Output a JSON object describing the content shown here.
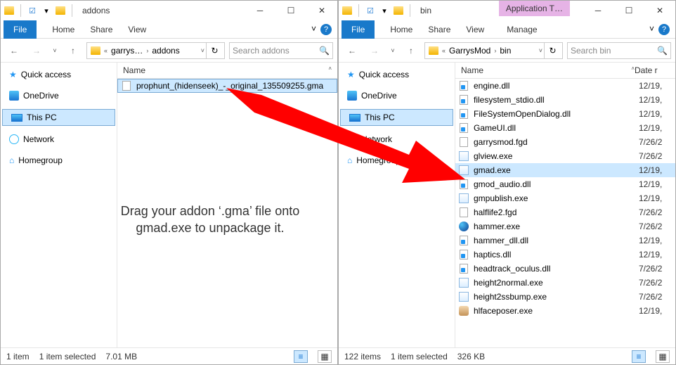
{
  "left": {
    "title": "addons",
    "ribbon": {
      "file": "File",
      "home": "Home",
      "share": "Share",
      "view": "View"
    },
    "breadcrumbs": [
      "garrys…",
      "addons"
    ],
    "search_placeholder": "Search addons",
    "nav": {
      "quick": "Quick access",
      "onedrive": "OneDrive",
      "thispc": "This PC",
      "network": "Network",
      "homegroup": "Homegroup"
    },
    "columns": {
      "name": "Name"
    },
    "files": [
      {
        "name": "prophunt_(hidenseek)_-_original_135509255.gma"
      }
    ],
    "status": {
      "count": "1 item",
      "sel": "1 item selected",
      "size": "7.01 MB"
    }
  },
  "right": {
    "title": "bin",
    "context_tab": "Application T…",
    "ribbon": {
      "file": "File",
      "home": "Home",
      "share": "Share",
      "view": "View",
      "manage": "Manage"
    },
    "breadcrumbs": [
      "GarrysMod",
      "bin"
    ],
    "search_placeholder": "Search bin",
    "nav": {
      "quick": "Quick access",
      "onedrive": "OneDrive",
      "thispc": "This PC",
      "network": "Network",
      "homegroup": "Homegroup"
    },
    "columns": {
      "name": "Name",
      "date": "Date r"
    },
    "files": [
      {
        "name": "engine.dll",
        "date": "12/19,",
        "type": "dll"
      },
      {
        "name": "filesystem_stdio.dll",
        "date": "12/19,",
        "type": "dll"
      },
      {
        "name": "FileSystemOpenDialog.dll",
        "date": "12/19,",
        "type": "dll"
      },
      {
        "name": "GameUI.dll",
        "date": "12/19,",
        "type": "dll"
      },
      {
        "name": "garrysmod.fgd",
        "date": "7/26/2",
        "type": "file"
      },
      {
        "name": "glview.exe",
        "date": "7/26/2",
        "type": "exe"
      },
      {
        "name": "gmad.exe",
        "date": "12/19,",
        "type": "exe",
        "sel": true
      },
      {
        "name": "gmod_audio.dll",
        "date": "12/19,",
        "type": "dll"
      },
      {
        "name": "gmpublish.exe",
        "date": "12/19,",
        "type": "exe"
      },
      {
        "name": "halflife2.fgd",
        "date": "7/26/2",
        "type": "file"
      },
      {
        "name": "hammer.exe",
        "date": "7/26/2",
        "type": "globe"
      },
      {
        "name": "hammer_dll.dll",
        "date": "12/19,",
        "type": "dll"
      },
      {
        "name": "haptics.dll",
        "date": "12/19,",
        "type": "dll"
      },
      {
        "name": "headtrack_oculus.dll",
        "date": "7/26/2",
        "type": "dll"
      },
      {
        "name": "height2normal.exe",
        "date": "7/26/2",
        "type": "exe"
      },
      {
        "name": "height2ssbump.exe",
        "date": "7/26/2",
        "type": "exe"
      },
      {
        "name": "hlfaceposer.exe",
        "date": "12/19,",
        "type": "face"
      }
    ],
    "status": {
      "count": "122 items",
      "sel": "1 item selected",
      "size": "326 KB"
    }
  },
  "caption": "Drag your addon ‘.gma’ file onto gmad.exe to unpackage it."
}
